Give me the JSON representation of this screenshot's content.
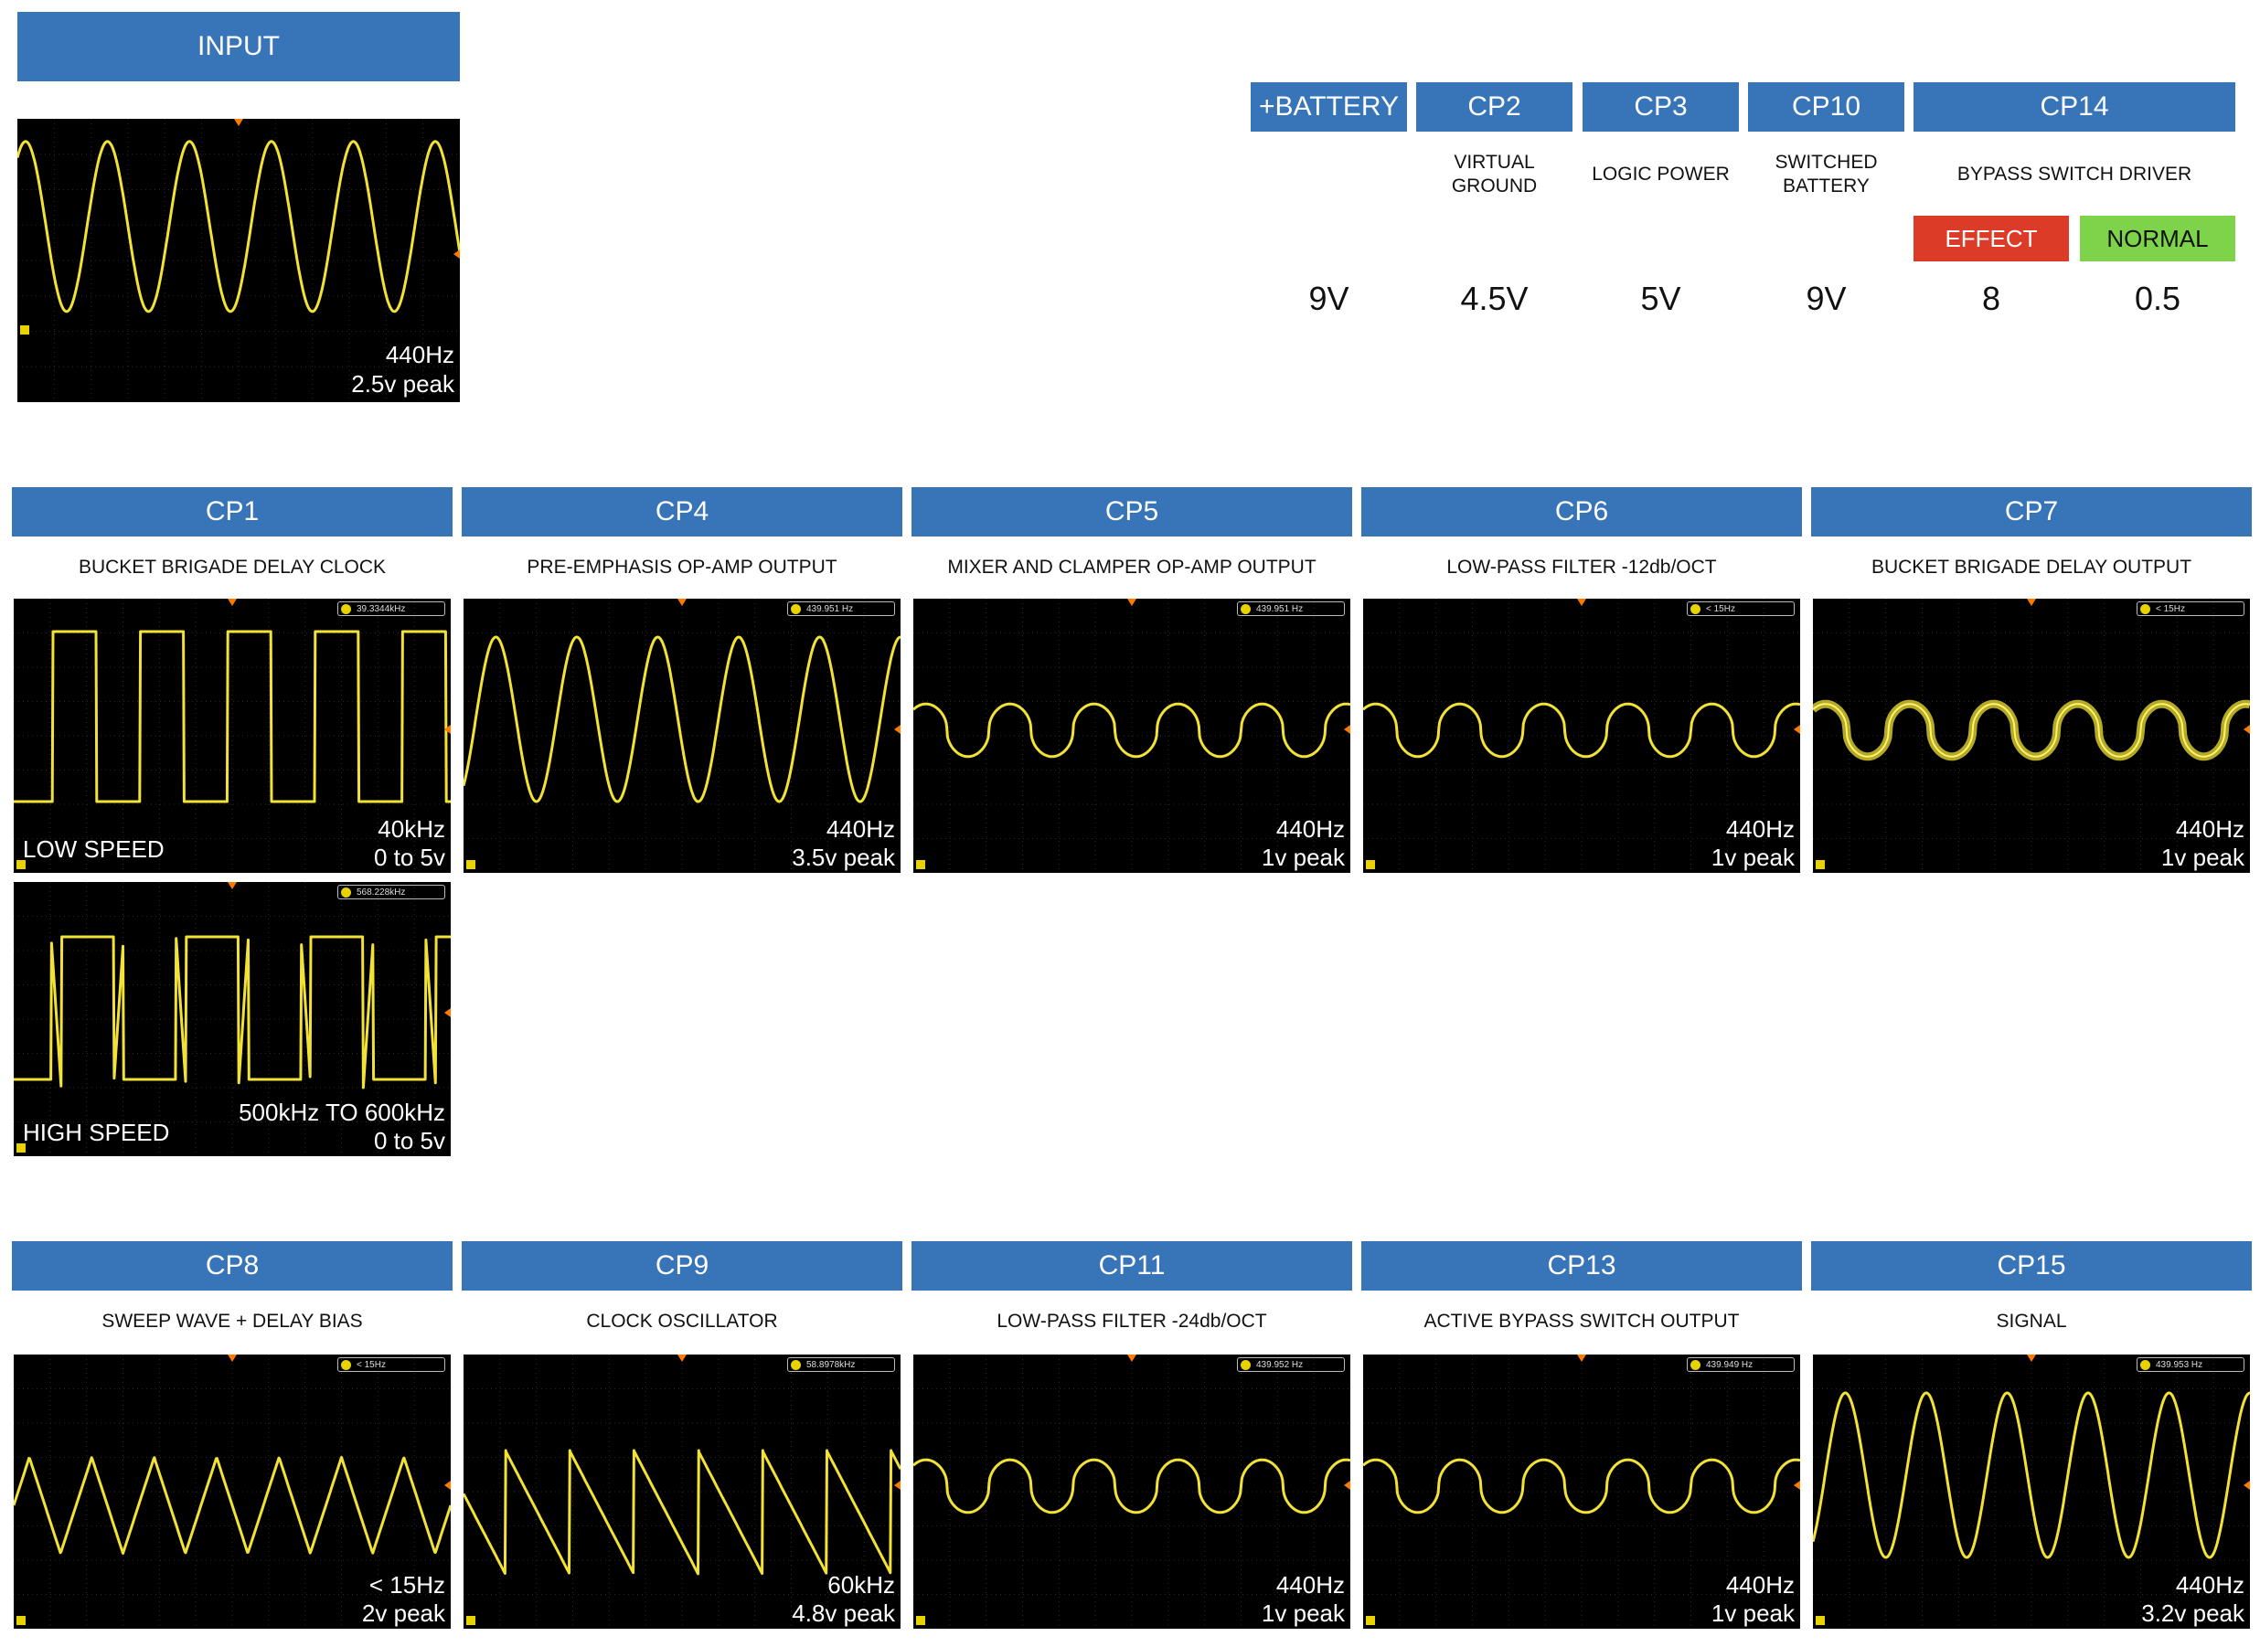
{
  "input": {
    "title": "INPUT",
    "label1": "440Hz",
    "label2": "2.5v peak"
  },
  "dc_points": [
    {
      "id": "battery",
      "title": "+BATTERY",
      "desc": "",
      "voltage": "9V"
    },
    {
      "id": "cp2",
      "title": "CP2",
      "desc": "VIRTUAL GROUND",
      "voltage": "4.5V"
    },
    {
      "id": "cp3",
      "title": "CP3",
      "desc": "LOGIC POWER",
      "voltage": "5V"
    },
    {
      "id": "cp10",
      "title": "CP10",
      "desc": "SWITCHED BATTERY",
      "voltage": "9V"
    }
  ],
  "cp14": {
    "title": "CP14",
    "desc": "BYPASS SWITCH DRIVER",
    "effect_label": "EFFECT",
    "normal_label": "NORMAL",
    "effect_value": "8",
    "normal_value": "0.5",
    "effect_color": "#dc3b28",
    "normal_color": "#7dd44a"
  },
  "colors": {
    "header": "#3874b8",
    "trace": "#f2e236",
    "scope_bg": "#000000"
  },
  "row1": [
    {
      "id": "cp1",
      "title": "CP1",
      "desc": "BUCKET BRIGADE DELAY CLOCK",
      "scopes": [
        {
          "name": "cp1-low-speed",
          "wave": "square",
          "badge": "39.3344kHz",
          "label1": "40kHz",
          "label2": "0 to 5v",
          "side_label": "LOW SPEED"
        },
        {
          "name": "cp1-high-speed",
          "wave": "square-slow",
          "badge": "568.228kHz",
          "label1": "500kHz TO 600kHz",
          "label2": "0 to 5v",
          "side_label": "HIGH SPEED"
        }
      ]
    },
    {
      "id": "cp4",
      "title": "CP4",
      "desc": "PRE-EMPHASIS OP-AMP OUTPUT",
      "scopes": [
        {
          "name": "cp4-scope",
          "wave": "sine-large",
          "badge": "439.951 Hz",
          "label1": "440Hz",
          "label2": "3.5v peak"
        }
      ]
    },
    {
      "id": "cp5",
      "title": "CP5",
      "desc": "MIXER AND CLAMPER OP-AMP OUTPUT",
      "scopes": [
        {
          "name": "cp5-scope",
          "wave": "bumpy",
          "badge": "439.951 Hz",
          "label1": "440Hz",
          "label2": "1v peak"
        }
      ]
    },
    {
      "id": "cp6",
      "title": "CP6",
      "desc": "LOW-PASS FILTER -12db/OCT",
      "scopes": [
        {
          "name": "cp6-scope",
          "wave": "bumpy",
          "badge": "< 15Hz",
          "label1": "440Hz",
          "label2": "1v peak"
        }
      ]
    },
    {
      "id": "cp7",
      "title": "CP7",
      "desc": "BUCKET BRIGADE DELAY OUTPUT",
      "scopes": [
        {
          "name": "cp7-scope",
          "wave": "bumpy-thick",
          "badge": "< 15Hz",
          "label1": "440Hz",
          "label2": "1v peak"
        }
      ]
    }
  ],
  "row2": [
    {
      "id": "cp8",
      "title": "CP8",
      "desc": "SWEEP WAVE + DELAY BIAS",
      "scopes": [
        {
          "name": "cp8-scope",
          "wave": "triangle",
          "badge": "< 15Hz",
          "label1": "< 15Hz",
          "label2": "2v peak"
        }
      ]
    },
    {
      "id": "cp9",
      "title": "CP9",
      "desc": "CLOCK OSCILLATOR",
      "scopes": [
        {
          "name": "cp9-scope",
          "wave": "sawtooth",
          "badge": "58.8978kHz",
          "label1": "60kHz",
          "label2": "4.8v peak"
        }
      ]
    },
    {
      "id": "cp11",
      "title": "CP11",
      "desc": "LOW-PASS FILTER -24db/OCT",
      "scopes": [
        {
          "name": "cp11-scope",
          "wave": "bumpy",
          "badge": "439.952 Hz",
          "label1": "440Hz",
          "label2": "1v peak"
        }
      ]
    },
    {
      "id": "cp13",
      "title": "CP13",
      "desc": "ACTIVE BYPASS SWITCH OUTPUT",
      "scopes": [
        {
          "name": "cp13-scope",
          "wave": "bumpy",
          "badge": "439.949 Hz",
          "label1": "440Hz",
          "label2": "1v peak"
        }
      ]
    },
    {
      "id": "cp15",
      "title": "CP15",
      "desc": "SIGNAL",
      "scopes": [
        {
          "name": "cp15-scope",
          "wave": "sine-large",
          "badge": "439.953 Hz",
          "label1": "440Hz",
          "label2": "3.2v peak"
        }
      ]
    }
  ]
}
